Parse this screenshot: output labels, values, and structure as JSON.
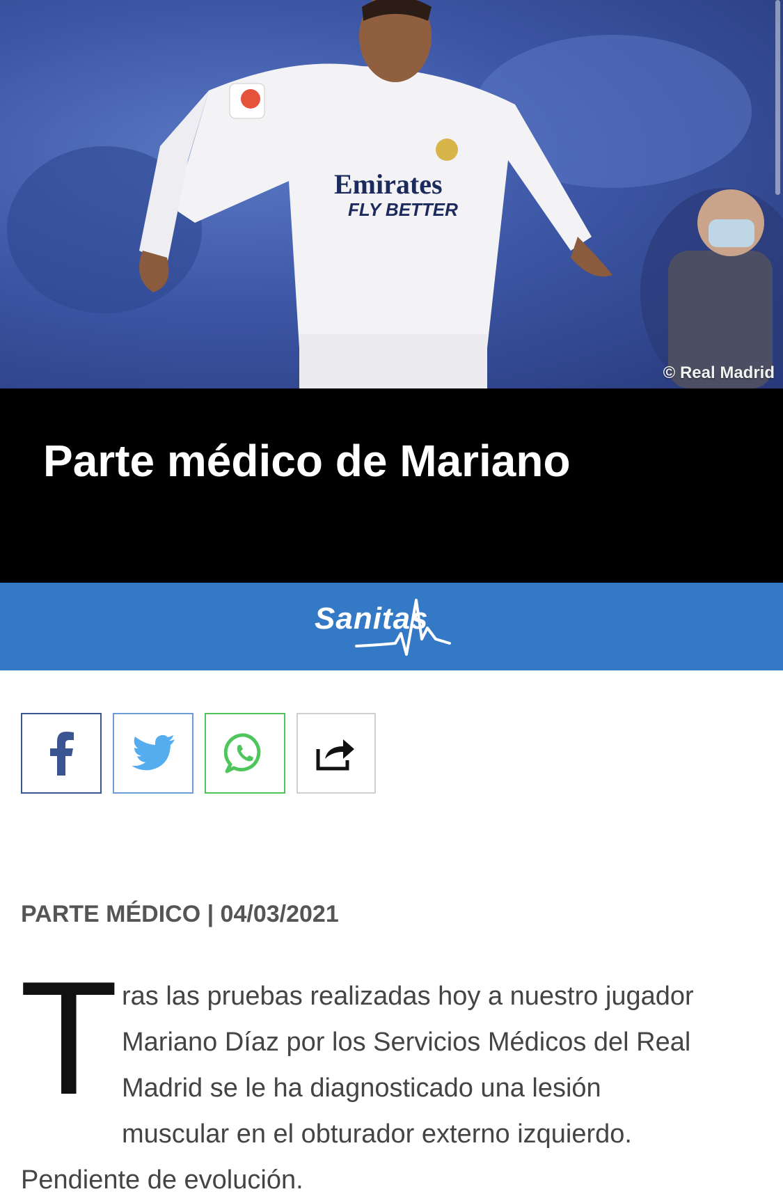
{
  "hero": {
    "image_alt": "player-photo",
    "credit": "© Real Madrid"
  },
  "article": {
    "title": "Parte médico de Mariano",
    "meta": "PARTE MÉDICO | 04/03/2021",
    "drop_cap": "T",
    "lines": [
      "ras las pruebas realizadas hoy a nuestro jugador",
      "Mariano Díaz por los Servicios Médicos del Real",
      "Madrid se le ha diagnosticado una lesión",
      "muscular en el obturador externo izquierdo."
    ],
    "last_line": "Pendiente de evolución."
  },
  "sponsor": {
    "name": "Sanitas"
  },
  "share": {
    "buttons": [
      {
        "name": "facebook",
        "icon": "facebook-icon",
        "color": "#3b5592"
      },
      {
        "name": "twitter",
        "icon": "twitter-icon",
        "color": "#55acee"
      },
      {
        "name": "whatsapp",
        "icon": "whatsapp-icon",
        "color": "#4fc65b"
      },
      {
        "name": "share",
        "icon": "share-icon",
        "color": "#111111"
      }
    ]
  },
  "colors": {
    "title_band": "#000000",
    "sponsor_band": "#3479c6",
    "meta_text": "#555555",
    "body_text": "#444444"
  }
}
